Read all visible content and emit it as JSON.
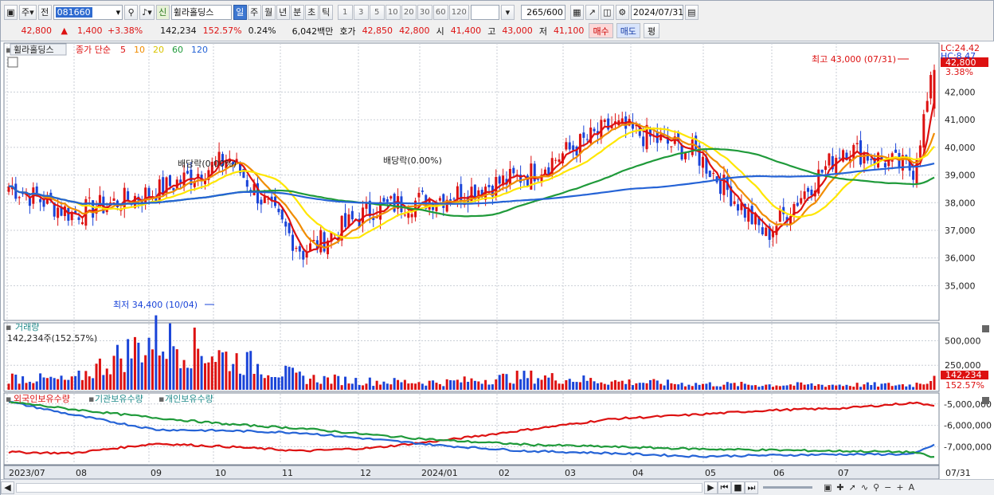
{
  "toolbar": {
    "market": "주",
    "period_prefix": "전",
    "code": "081660",
    "name": "휠라홀딩스",
    "credit_badge": "신",
    "periods": [
      "일",
      "주",
      "월",
      "년",
      "분",
      "초",
      "틱"
    ],
    "selected_period": "일",
    "intervals": [
      "1",
      "3",
      "5",
      "10",
      "20",
      "30",
      "60",
      "120"
    ],
    "count": "265",
    "count_total": "/600",
    "date": "2024/07/31"
  },
  "quote": {
    "price": "42,800",
    "arrow": "▲",
    "change": "1,400",
    "change_pct": "+3.38%",
    "volume": "142,234",
    "volume_ratio": "152.57%",
    "turnover": "0.24%",
    "amount": "6,042백만",
    "ask_label": "호가",
    "ask": "42,850",
    "bid": "42,800",
    "open_label": "시",
    "open": "41,400",
    "high_label": "고",
    "high": "43,000",
    "low_label": "저",
    "low": "41,100",
    "buy_label": "매수",
    "sell_label": "매도",
    "avg_label": "평"
  },
  "price_panel": {
    "name_tag": "휠라홀딩스",
    "ma_label": "종가 단순",
    "ma_periods": [
      "5",
      "10",
      "20",
      "60",
      "120"
    ],
    "lc_label": "LC:24.42",
    "hc_label": "HC:8.47",
    "last_price_tag": "42,800",
    "last_pct_tag": "3.38%",
    "high_annot": "최고 43,000 (07/31)",
    "low_annot": "최저 34,400 (10/04)",
    "div1": "배당락(0.00%)",
    "div2": "배당락(0.00%)",
    "y_ticks": [
      "42,000",
      "41,000",
      "40,000",
      "39,000",
      "38,000",
      "37,000",
      "36,000",
      "35,000"
    ]
  },
  "volume_panel": {
    "title": "거래량",
    "value_label": "142,234주(152.57%)",
    "y_ticks": [
      "500,000",
      "250,000"
    ],
    "last_tag": "142,234",
    "last_pct": "152.57%"
  },
  "holder_panel": {
    "foreign": "외국인보유수량",
    "institution": "기관보유수량",
    "individual": "개인보유수량",
    "y_ticks": [
      "-5,000,000",
      "-6,000,000",
      "-7,000,000"
    ]
  },
  "x_axis": {
    "labels": [
      "2023/07",
      "08",
      "09",
      "10",
      "11",
      "12",
      "2024/01",
      "02",
      "03",
      "04",
      "05",
      "06",
      "07"
    ],
    "last_label": "07/31"
  },
  "colors": {
    "up": "#dd1111",
    "down": "#1a44d8",
    "ma5": "#dd1111",
    "ma10": "#f08c00",
    "ma20": "#ffe600",
    "ma60": "#1f9a3a",
    "ma120": "#2563d6"
  },
  "chart_data": {
    "type": "candlestick",
    "title": "휠라홀딩스 일봉",
    "x_range": [
      "2023/07",
      "2024/07/31"
    ],
    "ylim": [
      34400,
      43000
    ],
    "last": {
      "date": "07/31",
      "close": 42800,
      "open": 41400,
      "high": 43000,
      "low": 41100,
      "volume": 142234
    },
    "period_high": {
      "value": 43000,
      "date": "07/31"
    },
    "period_low": {
      "value": 34400,
      "date": "10/04"
    },
    "close_profile": {
      "x": [
        "2023/07",
        "08",
        "09",
        "10",
        "11",
        "12",
        "2024/01",
        "02",
        "03",
        "04",
        "05",
        "06",
        "07",
        "07/31"
      ],
      "values": [
        38600,
        37600,
        38400,
        39600,
        36200,
        37800,
        38200,
        39000,
        40800,
        39800,
        36800,
        40000,
        39200,
        42800
      ]
    },
    "volume_profile": {
      "x": [
        "2023/07",
        "08",
        "09",
        "10",
        "11",
        "12",
        "2024/01",
        "02",
        "03",
        "04",
        "05",
        "06",
        "07",
        "07/31"
      ],
      "values": [
        150000,
        110000,
        620000,
        380000,
        140000,
        100000,
        90000,
        160000,
        100000,
        70000,
        60000,
        60000,
        60000,
        142234
      ]
    },
    "series": [
      {
        "name": "외국인보유수량",
        "x": [
          "2023/07",
          "08",
          "09",
          "10",
          "11",
          "12",
          "2024/01",
          "02",
          "03",
          "04",
          "05",
          "06",
          "07",
          "07/31"
        ],
        "values": [
          -7250000,
          -7300000,
          -6850000,
          -7000000,
          -7200000,
          -7050000,
          -6700000,
          -6200000,
          -5700000,
          -5500000,
          -5300000,
          -5200000,
          -4950000,
          -5050000
        ]
      },
      {
        "name": "기관보유수량",
        "x": [
          "2023/07",
          "08",
          "09",
          "10",
          "11",
          "12",
          "2024/01",
          "02",
          "03",
          "04",
          "05",
          "06",
          "07",
          "07/31"
        ],
        "values": [
          -4900000,
          -5500000,
          -6200000,
          -6250000,
          -6350000,
          -6650000,
          -6950000,
          -7200000,
          -7300000,
          -7450000,
          -7400000,
          -7350000,
          -7350000,
          -6900000
        ]
      },
      {
        "name": "개인보유수량",
        "x": [
          "2023/07",
          "08",
          "09",
          "10",
          "11",
          "12",
          "2024/01",
          "02",
          "03",
          "04",
          "05",
          "06",
          "07",
          "07/31"
        ],
        "values": [
          -4900000,
          -5250000,
          -5650000,
          -5950000,
          -6150000,
          -6450000,
          -6700000,
          -6900000,
          -7000000,
          -7100000,
          -7150000,
          -7200000,
          -7250000,
          -7500000
        ]
      }
    ]
  }
}
